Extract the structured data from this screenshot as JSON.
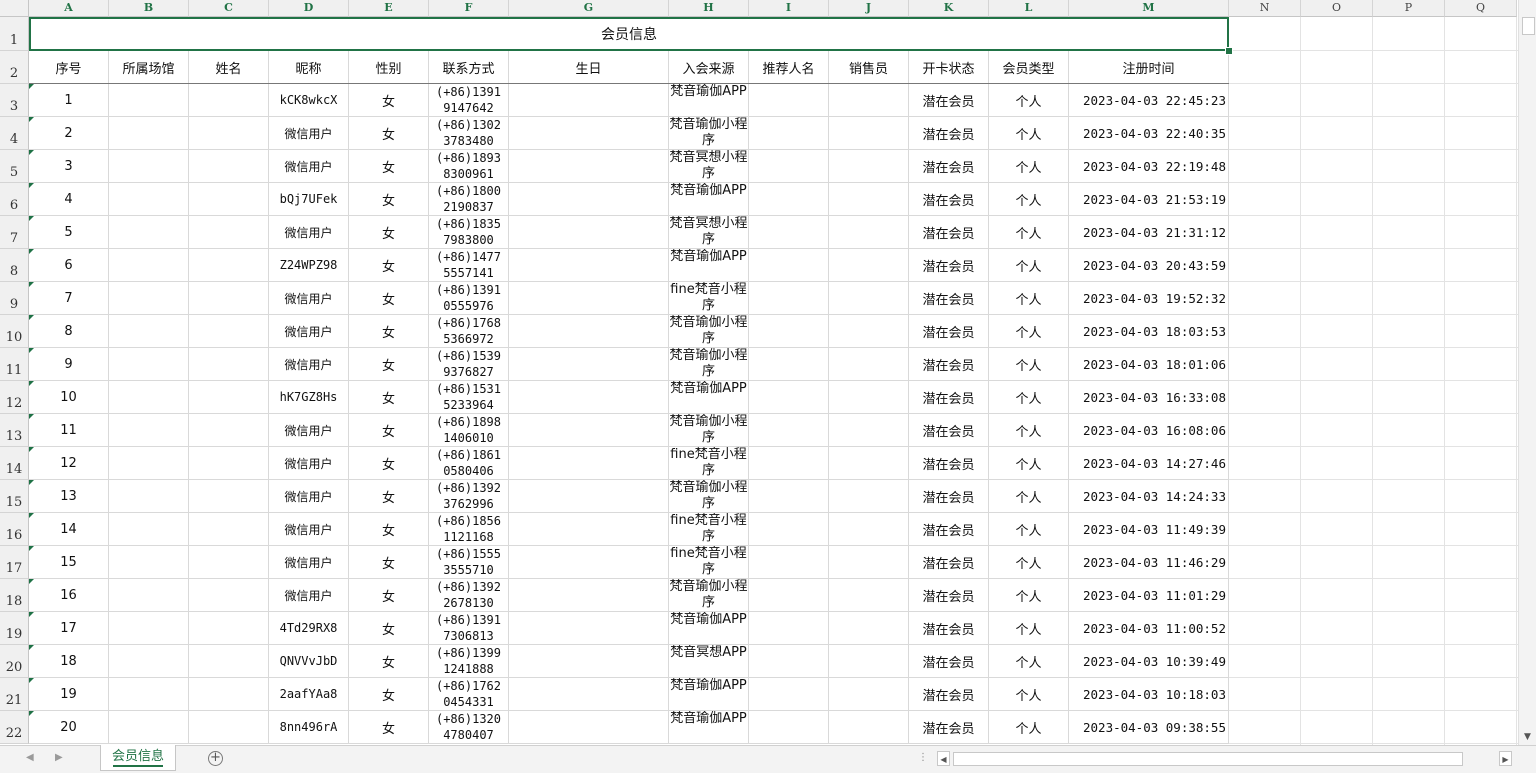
{
  "column_letters": [
    "A",
    "B",
    "C",
    "D",
    "E",
    "F",
    "G",
    "H",
    "I",
    "J",
    "K",
    "L",
    "M",
    "N",
    "O",
    "P",
    "Q"
  ],
  "title": "会员信息",
  "headers": [
    "序号",
    "所属场馆",
    "姓名",
    "昵称",
    "性别",
    "联系方式",
    "生日",
    "入会来源",
    "推荐人名",
    "销售员",
    "开卡状态",
    "会员类型",
    "注册时间"
  ],
  "rows": [
    {
      "n": "1",
      "nick": "kCK8wkcX",
      "sex": "女",
      "phone": "(+86)1391 9147642",
      "src": "梵音瑜伽APP",
      "status": "潜在会员",
      "type": "个人",
      "time": "2023-04-03 22:45:23"
    },
    {
      "n": "2",
      "nick": "微信用户",
      "sex": "女",
      "phone": "(+86)1302 3783480",
      "src": "梵音瑜伽小程序",
      "status": "潜在会员",
      "type": "个人",
      "time": "2023-04-03 22:40:35"
    },
    {
      "n": "3",
      "nick": "微信用户",
      "sex": "女",
      "phone": "(+86)1893 8300961",
      "src": "梵音冥想小程序",
      "status": "潜在会员",
      "type": "个人",
      "time": "2023-04-03 22:19:48"
    },
    {
      "n": "4",
      "nick": "bQj7UFek",
      "sex": "女",
      "phone": "(+86)1800 2190837",
      "src": "梵音瑜伽APP",
      "status": "潜在会员",
      "type": "个人",
      "time": "2023-04-03 21:53:19"
    },
    {
      "n": "5",
      "nick": "微信用户",
      "sex": "女",
      "phone": "(+86)1835 7983800",
      "src": "梵音冥想小程序",
      "status": "潜在会员",
      "type": "个人",
      "time": "2023-04-03 21:31:12"
    },
    {
      "n": "6",
      "nick": "Z24WPZ98",
      "sex": "女",
      "phone": "(+86)1477 5557141",
      "src": "梵音瑜伽APP",
      "status": "潜在会员",
      "type": "个人",
      "time": "2023-04-03 20:43:59"
    },
    {
      "n": "7",
      "nick": "微信用户",
      "sex": "女",
      "phone": "(+86)1391 0555976",
      "src": "fine梵音小程序",
      "status": "潜在会员",
      "type": "个人",
      "time": "2023-04-03 19:52:32"
    },
    {
      "n": "8",
      "nick": "微信用户",
      "sex": "女",
      "phone": "(+86)1768 5366972",
      "src": "梵音瑜伽小程序",
      "status": "潜在会员",
      "type": "个人",
      "time": "2023-04-03 18:03:53"
    },
    {
      "n": "9",
      "nick": "微信用户",
      "sex": "女",
      "phone": "(+86)1539 9376827",
      "src": "梵音瑜伽小程序",
      "status": "潜在会员",
      "type": "个人",
      "time": "2023-04-03 18:01:06"
    },
    {
      "n": "10",
      "nick": "hK7GZ8Hs",
      "sex": "女",
      "phone": "(+86)1531 5233964",
      "src": "梵音瑜伽APP",
      "status": "潜在会员",
      "type": "个人",
      "time": "2023-04-03 16:33:08"
    },
    {
      "n": "11",
      "nick": "微信用户",
      "sex": "女",
      "phone": "(+86)1898 1406010",
      "src": "梵音瑜伽小程序",
      "status": "潜在会员",
      "type": "个人",
      "time": "2023-04-03 16:08:06"
    },
    {
      "n": "12",
      "nick": "微信用户",
      "sex": "女",
      "phone": "(+86)1861 0580406",
      "src": "fine梵音小程序",
      "status": "潜在会员",
      "type": "个人",
      "time": "2023-04-03 14:27:46"
    },
    {
      "n": "13",
      "nick": "微信用户",
      "sex": "女",
      "phone": "(+86)1392 3762996",
      "src": "梵音瑜伽小程序",
      "status": "潜在会员",
      "type": "个人",
      "time": "2023-04-03 14:24:33"
    },
    {
      "n": "14",
      "nick": "微信用户",
      "sex": "女",
      "phone": "(+86)1856 1121168",
      "src": "fine梵音小程序",
      "status": "潜在会员",
      "type": "个人",
      "time": "2023-04-03 11:49:39"
    },
    {
      "n": "15",
      "nick": "微信用户",
      "sex": "女",
      "phone": "(+86)1555 3555710",
      "src": "fine梵音小程序",
      "status": "潜在会员",
      "type": "个人",
      "time": "2023-04-03 11:46:29"
    },
    {
      "n": "16",
      "nick": "微信用户",
      "sex": "女",
      "phone": "(+86)1392 2678130",
      "src": "梵音瑜伽小程序",
      "status": "潜在会员",
      "type": "个人",
      "time": "2023-04-03 11:01:29"
    },
    {
      "n": "17",
      "nick": "4Td29RX8",
      "sex": "女",
      "phone": "(+86)1391 7306813",
      "src": "梵音瑜伽APP",
      "status": "潜在会员",
      "type": "个人",
      "time": "2023-04-03 11:00:52"
    },
    {
      "n": "18",
      "nick": "QNVVvJbD",
      "sex": "女",
      "phone": "(+86)1399 1241888",
      "src": "梵音冥想APP",
      "status": "潜在会员",
      "type": "个人",
      "time": "2023-04-03 10:39:49"
    },
    {
      "n": "19",
      "nick": "2aafYAa8",
      "sex": "女",
      "phone": "(+86)1762 0454331",
      "src": "梵音瑜伽APP",
      "status": "潜在会员",
      "type": "个人",
      "time": "2023-04-03 10:18:03"
    },
    {
      "n": "20",
      "nick": "8nn496rA",
      "sex": "女",
      "phone": "(+86)1320 4780407",
      "src": "梵音瑜伽APP",
      "status": "潜在会员",
      "type": "个人",
      "time": "2023-04-03 09:38:55"
    }
  ],
  "sheet_tab": "会员信息",
  "add_sheet_icon": "plus-circle-icon",
  "accent_color": "#217346"
}
